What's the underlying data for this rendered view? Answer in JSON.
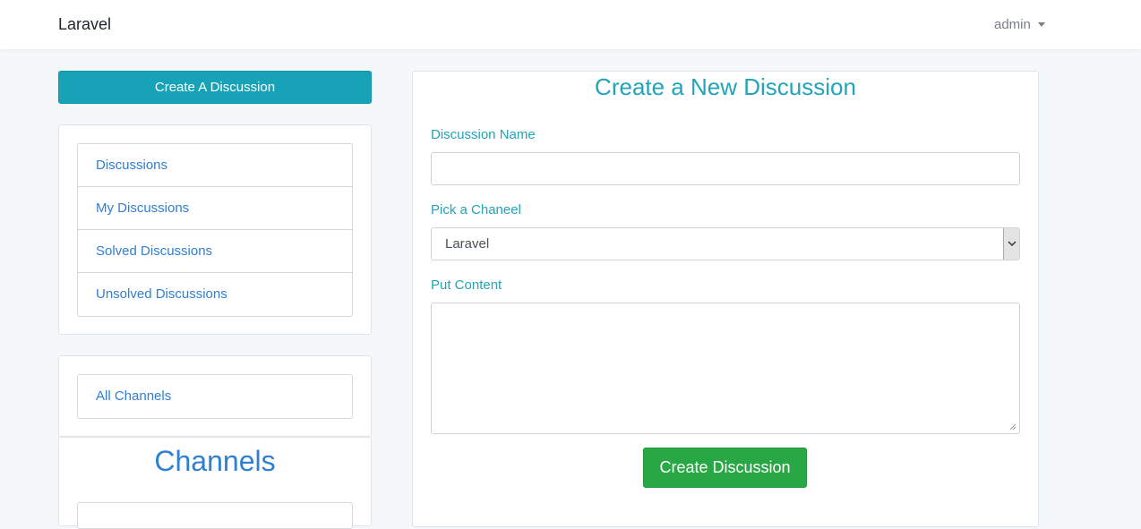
{
  "navbar": {
    "brand": "Laravel",
    "user": "admin"
  },
  "sidebar": {
    "create_button": "Create A Discussion",
    "filters": [
      {
        "label": "Discussions"
      },
      {
        "label": "My Discussions"
      },
      {
        "label": "Solved Discussions"
      },
      {
        "label": "Unsolved Discussions"
      }
    ],
    "all_channels": "All Channels",
    "channels_title": "Channels"
  },
  "form": {
    "title": "Create a New Discussion",
    "name_label": "Discussion Name",
    "name_value": "",
    "channel_label": "Pick a Chaneel",
    "channel_selected": "Laravel",
    "content_label": "Put Content",
    "content_value": "",
    "submit_label": "Create Discussion"
  },
  "colors": {
    "info": "#17a2b8",
    "success": "#28a745",
    "link": "#2f7fd3",
    "background": "#f5f8fa"
  }
}
